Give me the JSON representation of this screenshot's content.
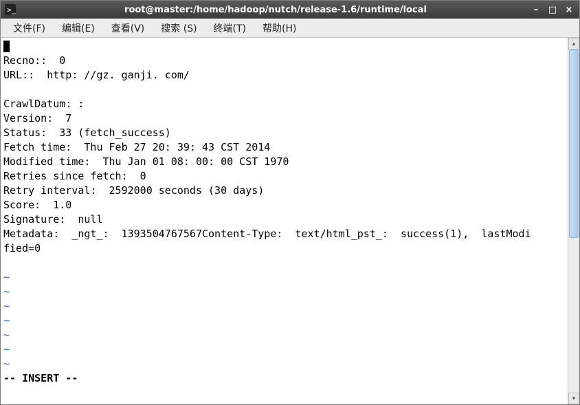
{
  "window": {
    "title": "root@master:/home/hadoop/nutch/release-1.6/runtime/local"
  },
  "menubar": {
    "items": [
      {
        "label": "文件(F)"
      },
      {
        "label": "编辑(E)"
      },
      {
        "label": "查看(V)"
      },
      {
        "label": "搜索 (S)"
      },
      {
        "label": "终端(T)"
      },
      {
        "label": "帮助(H)"
      }
    ]
  },
  "terminal": {
    "lines": {
      "l1": "Recno::  0",
      "l2": "URL::  http: //gz. ganji. com/",
      "l3": "",
      "l4": "CrawlDatum: :",
      "l5": "Version:  7",
      "l6": "Status:  33 (fetch_success)",
      "l7": "Fetch time:  Thu Feb 27 20: 39: 43 CST 2014",
      "l8": "Modified time:  Thu Jan 01 08: 00: 00 CST 1970",
      "l9": "Retries since fetch:  0",
      "l10": "Retry interval:  2592000 seconds (30 days)",
      "l11": "Score:  1.0",
      "l12": "Signature:  null",
      "l13": "Metadata:  _ngt_:  1393504767567Content-Type:  text/html_pst_:  success(1),  lastModi",
      "l14": "fied=0",
      "tilde": "~",
      "mode": "-- INSERT --"
    }
  },
  "titlebar_controls": {
    "minimize": "–",
    "maximize": "□",
    "close": "×"
  },
  "scroll": {
    "up": "▴",
    "down": "▾"
  }
}
